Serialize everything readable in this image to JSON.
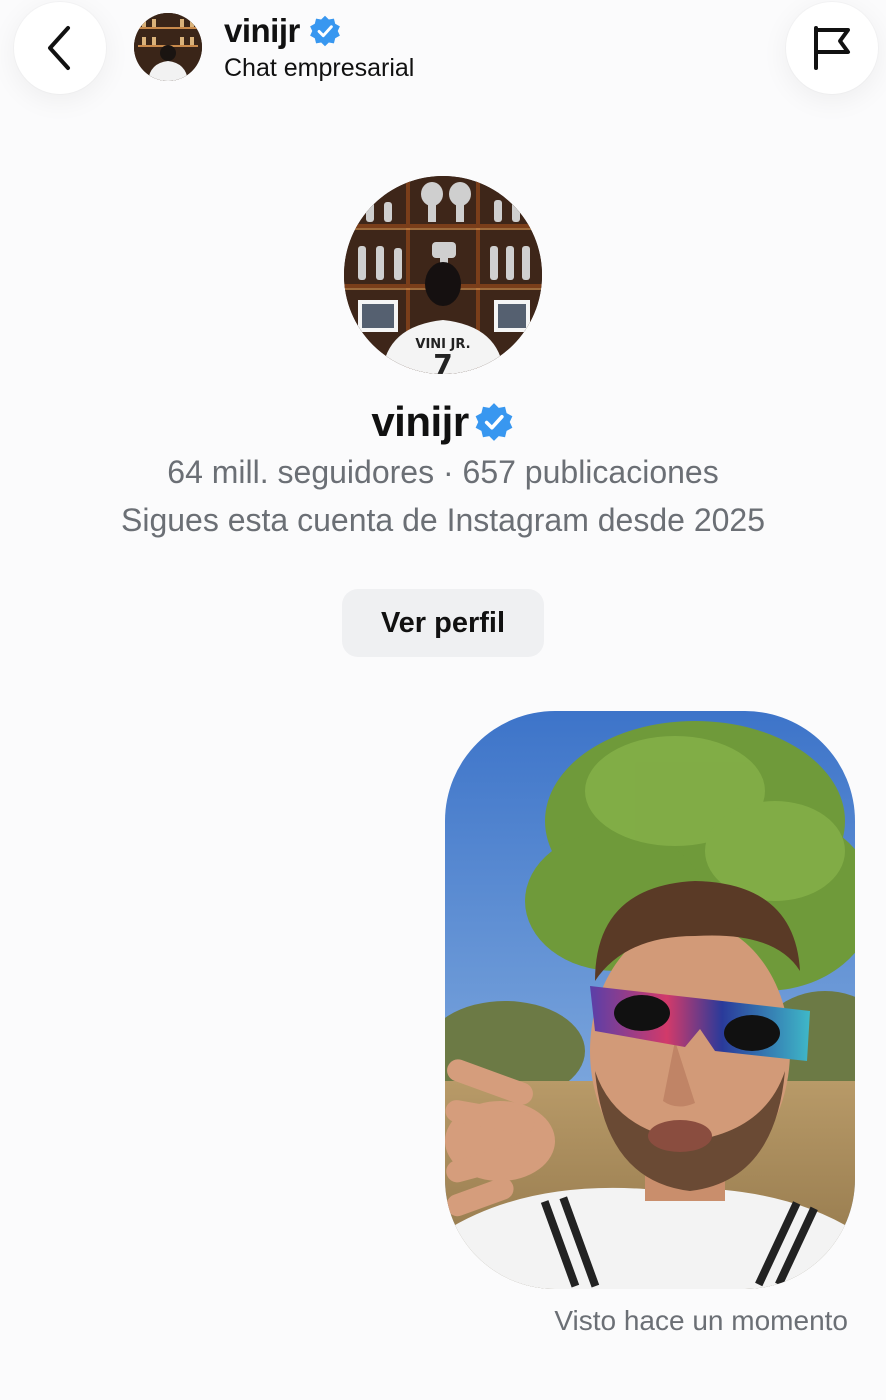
{
  "header": {
    "username": "vinijr",
    "subtitle": "Chat empresarial",
    "back_icon": "chevron-left-icon",
    "flag_icon": "flag-icon",
    "verified_icon": "verified-badge-icon"
  },
  "profile": {
    "username": "vinijr",
    "avatar_jersey_text": "VINI JR.",
    "stats": "64 mill. seguidores · 657 publicaciones",
    "following_since": "Sigues esta cuenta de Instagram desde 2025",
    "view_profile_label": "Ver perfil"
  },
  "conversation": {
    "message_type": "video/photo",
    "seen_status": "Visto hace un momento"
  },
  "colors": {
    "verified_blue": "#3897f0",
    "secondary_text": "#6b6f75",
    "button_bg": "#eff0f2",
    "background": "#fbfbfc"
  }
}
